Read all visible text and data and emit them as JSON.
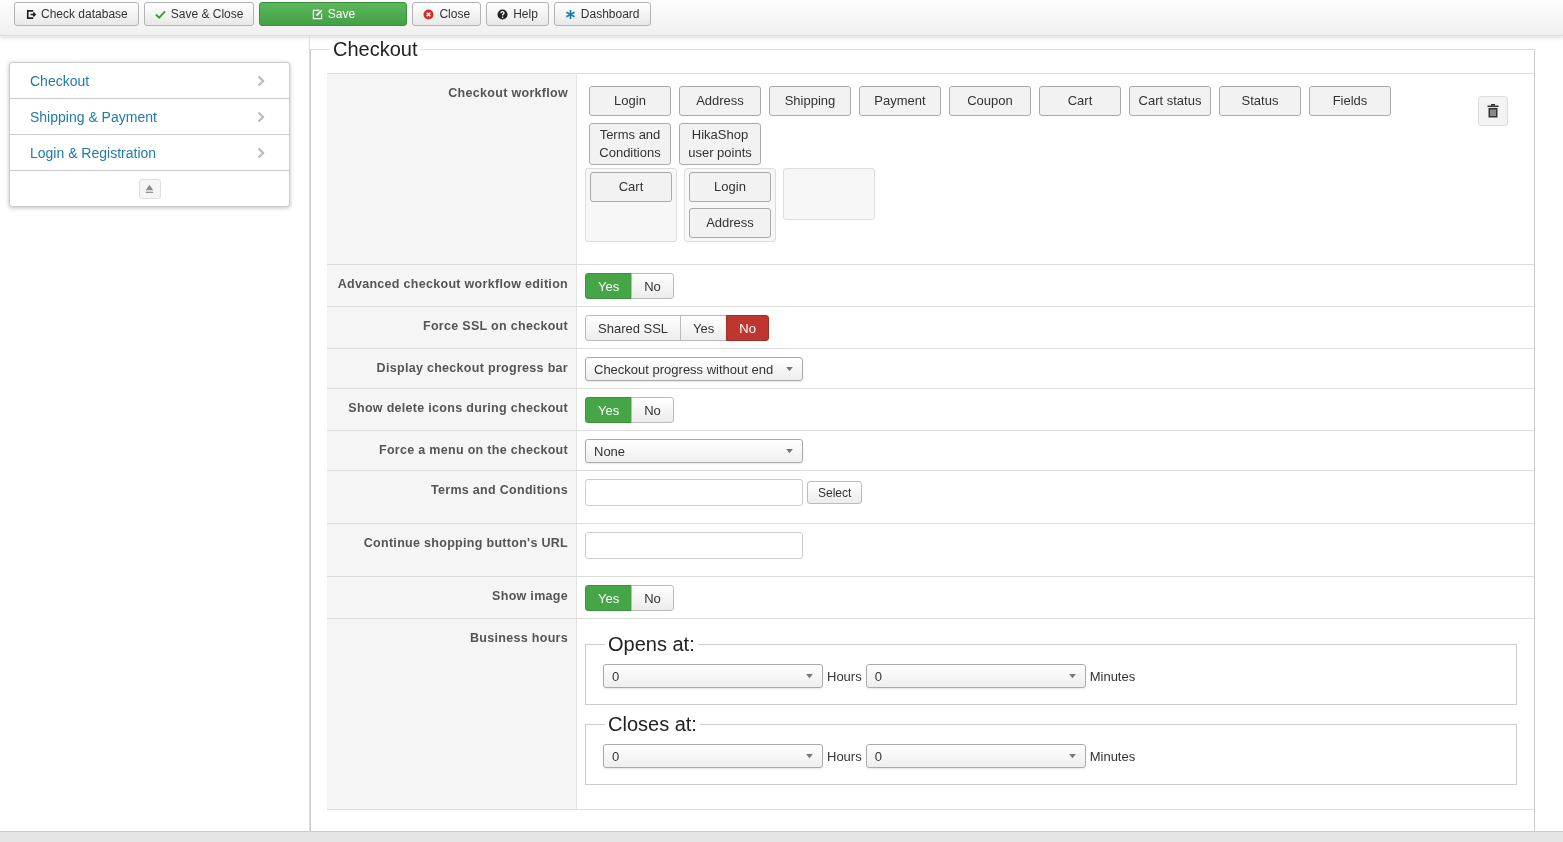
{
  "toolbar": [
    {
      "label": "Check database",
      "kind": "check-db"
    },
    {
      "label": "Save & Close",
      "kind": "save-close"
    },
    {
      "label": "Save",
      "kind": "save"
    },
    {
      "label": "Close",
      "kind": "close"
    },
    {
      "label": "Help",
      "kind": "help"
    },
    {
      "label": "Dashboard",
      "kind": "dashboard"
    }
  ],
  "sidebar": {
    "items": [
      {
        "label": "Checkout"
      },
      {
        "label": "Shipping & Payment"
      },
      {
        "label": "Login & Registration"
      }
    ]
  },
  "section": {
    "title": "Checkout"
  },
  "rows": [
    {
      "label": "Checkout workflow",
      "kind": "workflow",
      "pool": [
        "Login",
        "Address",
        "Shipping",
        "Payment",
        "Coupon",
        "Cart",
        "Cart status",
        "Status",
        "Fields",
        "Terms and Conditions",
        "HikaShop user points"
      ],
      "groups": [
        {
          "kind": "steps",
          "steps": [
            "Cart"
          ]
        },
        {
          "kind": "steps",
          "steps": [
            "Login",
            "Address"
          ]
        },
        {
          "kind": "empty"
        }
      ]
    },
    {
      "label": "Advanced checkout workflow edition",
      "kind": "toggle",
      "options": [
        {
          "label": "Yes",
          "kind": "positive",
          "selected": true
        },
        {
          "label": "No",
          "kind": "negative",
          "selected": false
        }
      ]
    },
    {
      "label": "Force SSL on checkout",
      "kind": "toggle",
      "options": [
        {
          "label": "Shared SSL",
          "kind": "positive",
          "selected": false
        },
        {
          "label": "Yes",
          "kind": "positive",
          "selected": false
        },
        {
          "label": "No",
          "kind": "negative",
          "selected": true
        }
      ]
    },
    {
      "label": "Display checkout progress bar",
      "kind": "select",
      "value": "Checkout progress without end"
    },
    {
      "label": "Show delete icons during checkout",
      "kind": "toggle",
      "options": [
        {
          "label": "Yes",
          "kind": "positive",
          "selected": true
        },
        {
          "label": "No",
          "kind": "negative",
          "selected": false
        }
      ]
    },
    {
      "label": "Force a menu on the checkout",
      "kind": "select",
      "value": "None"
    },
    {
      "label": "Terms and Conditions",
      "kind": "text_select",
      "button": "Select"
    },
    {
      "label": "Continue shopping button's URL",
      "kind": "text"
    },
    {
      "label": "Show image",
      "kind": "toggle",
      "options": [
        {
          "label": "Yes",
          "kind": "positive",
          "selected": true
        },
        {
          "label": "No",
          "kind": "negative",
          "selected": false
        }
      ]
    },
    {
      "label": "Business hours",
      "kind": "hours",
      "blocks": [
        {
          "legend": "Opens at:",
          "hours": "0",
          "hours_unit": "Hours",
          "minutes": "0",
          "minutes_unit": "Minutes"
        },
        {
          "legend": "Closes at:",
          "hours": "0",
          "hours_unit": "Hours",
          "minutes": "0",
          "minutes_unit": "Minutes"
        }
      ]
    }
  ]
}
